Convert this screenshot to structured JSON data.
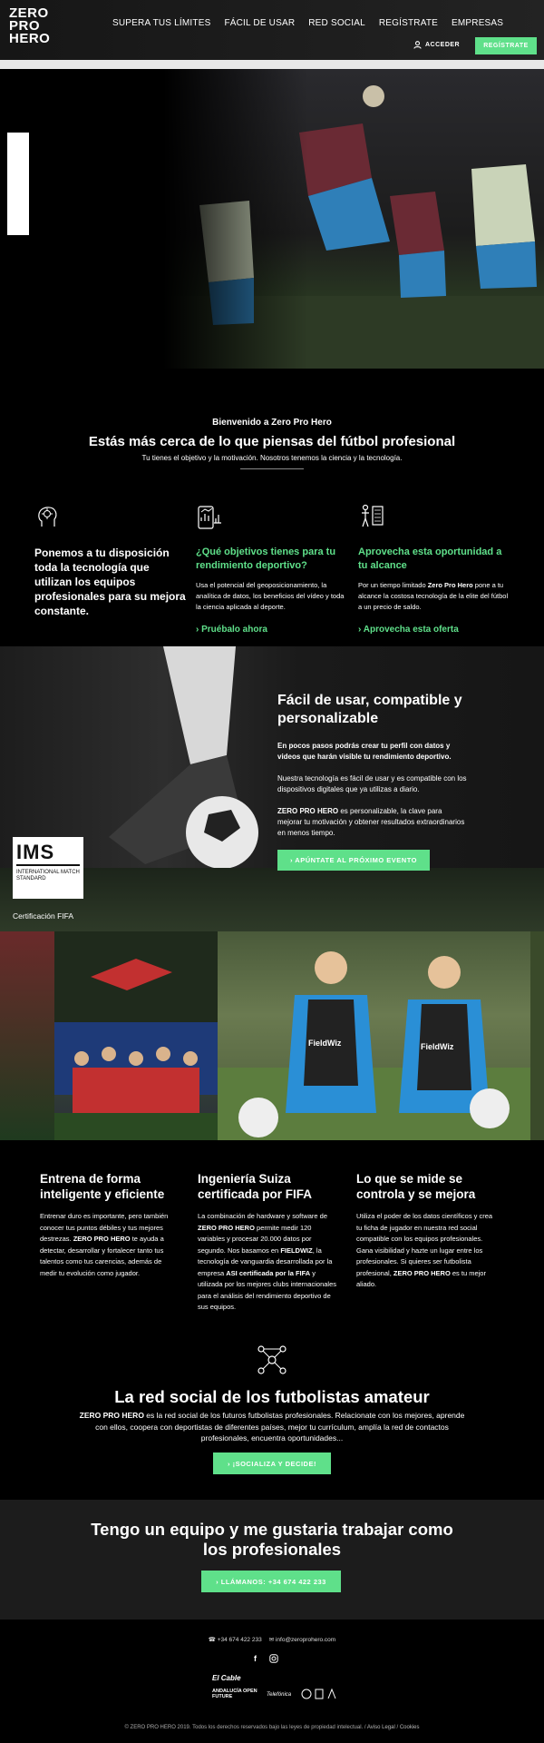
{
  "header": {
    "logo": [
      "ZERO",
      "PRO",
      "HERO"
    ],
    "nav": [
      "SUPERA TUS LÍMITES",
      "FÁCIL DE USAR",
      "RED SOCIAL",
      "REGÍSTRATE",
      "EMPRESAS"
    ],
    "login_label": "ACCEDER",
    "register_label": "REGÍSTRATE"
  },
  "welcome": {
    "kicker": "Bienvenido a Zero Pro Hero",
    "title": "Estás más cerca de lo que piensas del fútbol profesional",
    "subtitle": "Tu tienes el objetivo y la motivación. Nosotros tenemos la ciencia y la tecnología.",
    "features": [
      {
        "icon": "brain-head-icon",
        "title": "Ponemos a tu disposición toda la tecnología que utilizan los equipos profesionales para su mejora constante.",
        "text": "",
        "link": ""
      },
      {
        "icon": "analytics-phone-icon",
        "title": "¿Qué objetivos tienes para tu rendimiento deportivo?",
        "text": "Usa el potencial del geoposicionamiento, la analítica de datos, los beneficios del vídeo y toda la ciencia aplicada al deporte.",
        "link": "› Pruébalo ahora"
      },
      {
        "icon": "tactics-board-icon",
        "title": "Aprovecha esta oportunidad a tu alcance",
        "text_pre": "Por un tiempo limitado ",
        "text_bold": "Zero Pro Hero",
        "text_post": " pone a tu alcance la costosa tecnología de la elite del fútbol a un precio de saldo.",
        "link": "› Aprovecha esta oferta"
      }
    ]
  },
  "easy": {
    "title": "Fácil de usar, compatible y personalizable",
    "p1": "En pocos pasos podrás crear tu perfil con datos y videos que harán visible tu rendimiento deportivo.",
    "p2": "Nuestra tecnología es fácil de usar y es compatible con los dispositivos digitales que ya utilizas a diario.",
    "p3_bold": "ZERO PRO HERO",
    "p3_rest": " es personalizable, la clave para mejorar tu motivación y obtener resultados extraordinarios en menos tiempo.",
    "button": "› APÚNTATE AL PRÓXIMO EVENTO",
    "badge_title": "IMS",
    "badge_text": "INTERNATIONAL MATCH STANDARD",
    "badge_caption": "Certificación FIFA"
  },
  "photos": {
    "shirt_text": "FieldWiz"
  },
  "columns": [
    {
      "title": "Entrena de forma inteligente y eficiente",
      "text_a": "Entrenar duro es importante, pero también conocer tus puntos débiles y tus mejores destrezas. ",
      "text_bold": "ZERO PRO HERO",
      "text_b": " te ayuda a detectar, desarrollar y fortalecer tanto tus talentos como tus carencias, además de medir tu evolución como jugador."
    },
    {
      "title": "Ingeniería Suiza certificada por FIFA",
      "text_a": "La combinación de hardware y software de ",
      "text_bold": "ZERO PRO HERO",
      "text_b": " permite medir 120 variables y procesar 20.000 datos por segundo. Nos basamos en ",
      "text_bold2": "FIELDWIZ",
      "text_c": ", la tecnología de vanguardia desarrollada por la empresa ",
      "text_bold3": "ASI certificada por la FIFA",
      "text_d": " y utilizada por los mejores clubs internacionales para el análisis del rendimiento deportivo de sus equipos."
    },
    {
      "title": "Lo que se mide se controla y se mejora",
      "text_a": "Utiliza el poder de los datos científicos y crea tu ficha de jugador en nuestra red social compatible con los equipos profesionales. Gana visibilidad y hazte un lugar entre los profesionales. Si quieres ser futbolista profesional, ",
      "text_bold": "ZERO PRO HERO",
      "text_b": " es tu mejor aliado."
    }
  ],
  "social": {
    "title": "La red social de los futbolistas amateur",
    "text_bold": "ZERO PRO HERO",
    "text_rest": " es la red social de los futuros futbolistas profesionales. Relacionate con los mejores, aprende con ellos, coopera con deportistas de diferentes países, mejor tu currículum, amplía la red de contactos profesionales, encuentra oportunidades...",
    "button": "› ¡SOCIALIZA Y DECIDE!"
  },
  "team": {
    "title": "Tengo un equipo y me gustaria trabajar como los profesionales",
    "button": "› LLÁMANOS: +34 674 422 233"
  },
  "footer": {
    "phone": "+34 674 422 233",
    "email": "info@zeroprohero.com",
    "partners": [
      "El Cable",
      "ANDALUCÍA OPEN FUTURE",
      "Telefónica"
    ],
    "copyright": "© ZERO PRO HERO 2019. Todos los derechos reservados bajo las leyes de propiedad intelectual. / ",
    "legal": "Aviso Legal",
    "sep": " / ",
    "cookies": "Cookies"
  },
  "colors": {
    "accent": "#5fe08a",
    "background": "#000000"
  }
}
